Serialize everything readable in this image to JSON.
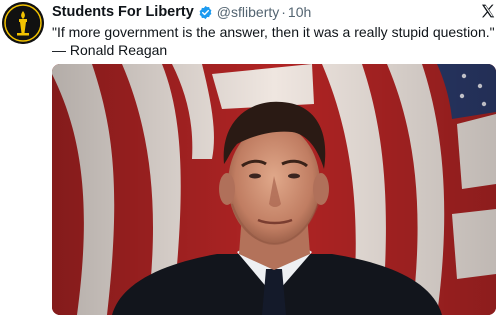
{
  "tweet": {
    "author": {
      "display_name": "Students For Liberty",
      "handle": "@sfliberty",
      "verified": true,
      "avatar_icon": "torch-logo-icon"
    },
    "separator": "·",
    "time": "10h",
    "text": "\"If more government is the answer, then it was a really stupid question.\" — Ronald Reagan",
    "platform_icon": "x-logo-icon",
    "media": {
      "type": "photo",
      "icon": "photo-portrait"
    }
  },
  "colors": {
    "verified_badge": "#1d9bf0",
    "secondary_text": "#536471",
    "primary_text": "#0f1419",
    "flag_red": "#b02424",
    "flag_white": "#efe6e0",
    "flag_blue": "#2b3a6b",
    "avatar_bg": "#111111",
    "avatar_accent": "#f2c200"
  }
}
